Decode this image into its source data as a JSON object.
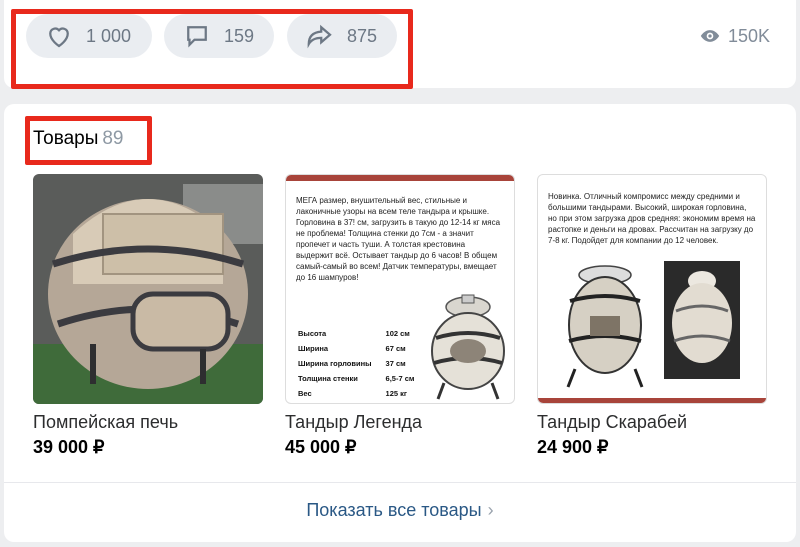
{
  "actions": {
    "likes": "1 000",
    "comments": "159",
    "shares": "875",
    "views": "150K"
  },
  "products_section": {
    "title": "Товары",
    "count": "89",
    "show_all": "Показать все товары",
    "items": [
      {
        "name": "Помпейская печь",
        "price": "39 000 ₽"
      },
      {
        "name": "Тандыр Легенда",
        "price": "45 000 ₽",
        "flyer_text": "МЕГА размер, внушительный вес, стильные и лаконичные узоры на всем теле тандыра и крышке. Горловина в 37! см, загрузить в такую до 12-14 кг мяса не проблема! Толщина стенки до 7см - а значит пропечет и часть туши. А толстая крестовина выдержит всё. Остывает тандыр до 6 часов! В общем самый-самый во всем! Датчик температуры, вмещает до 16 шампуров!",
        "specs": [
          {
            "label": "Высота",
            "value": "102 см"
          },
          {
            "label": "Ширина",
            "value": "67 см"
          },
          {
            "label": "Ширина горловины",
            "value": "37 см"
          },
          {
            "label": "Толщина стенки",
            "value": "6,5-7 см"
          },
          {
            "label": "Вес",
            "value": "125 кг"
          }
        ]
      },
      {
        "name": "Тандыр Скарабей",
        "price": "24 900 ₽",
        "flyer_text": "Новинка. Отличный компромисс между средними и большими тандырами. Высокий, широкая горловина, но при этом загрузка дров средняя: экономим время на растопке и деньги на дровах. Рассчитан на загрузку до 7-8 кг. Подойдет для компании до 12 человек."
      }
    ]
  },
  "colors": {
    "highlight_frame": "#e8291c",
    "link": "#2a5885",
    "pill_bg": "#eaedf1"
  }
}
